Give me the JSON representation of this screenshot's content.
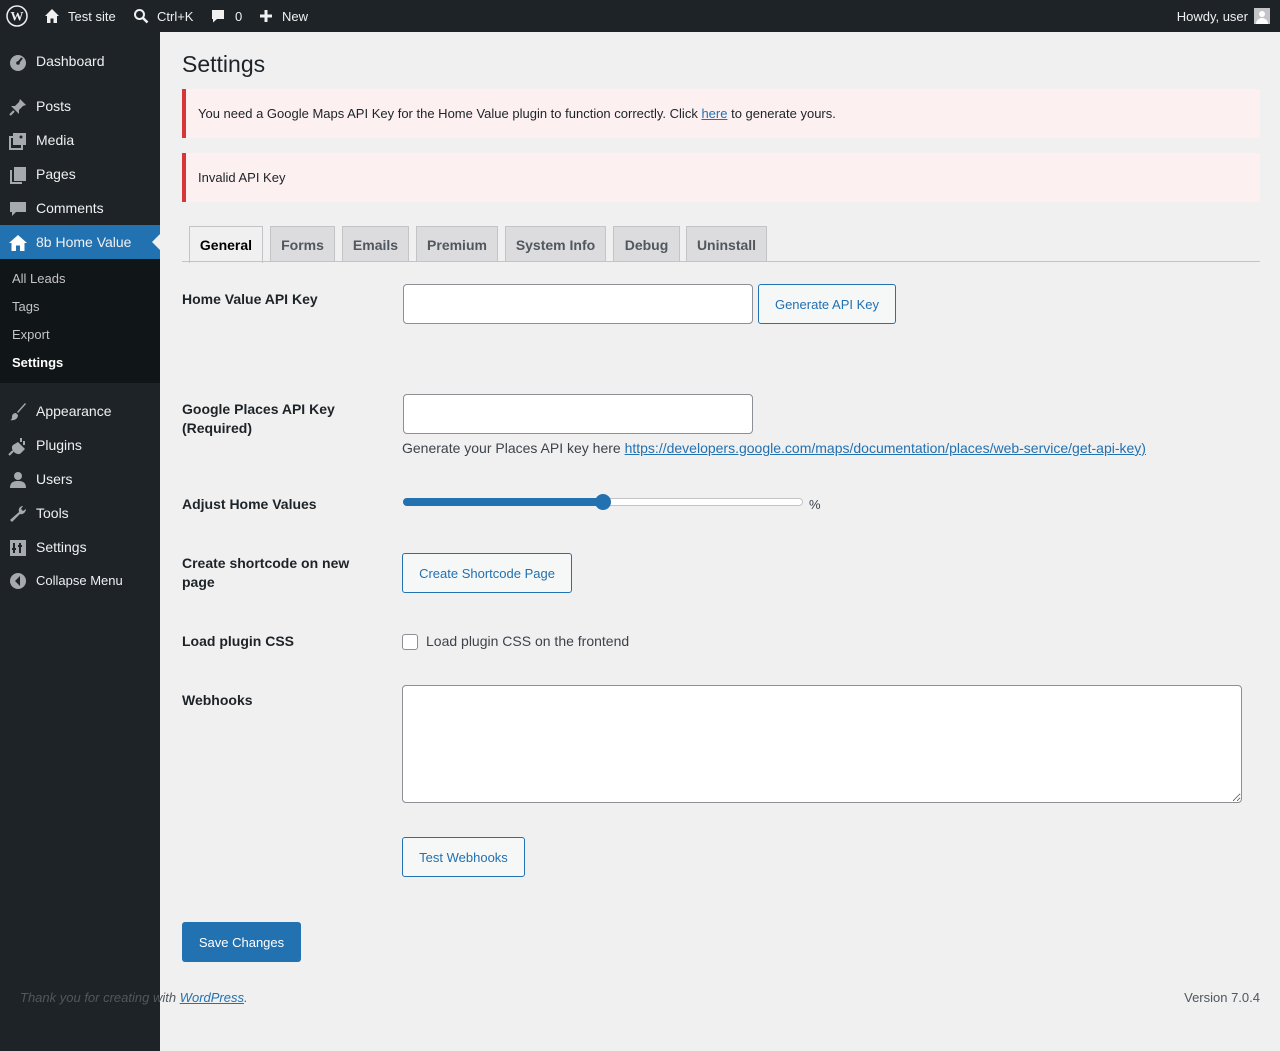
{
  "colors": {
    "adminbar_bg": "#1d2327",
    "accent": "#2271b1",
    "error": "#d63638"
  },
  "adminbar": {
    "site_name": "Test site",
    "search_shortcut": "Ctrl+K",
    "comments_count": "0",
    "new_label": "New",
    "greeting": "Howdy, user",
    "icons": [
      "wordpress-logo-icon",
      "home-icon",
      "search-icon",
      "comment-icon",
      "plus-icon",
      "avatar"
    ]
  },
  "sidebar": {
    "items": [
      {
        "label": "Dashboard",
        "icon": "dashboard-icon"
      },
      {
        "label": "Posts",
        "icon": "pin-icon"
      },
      {
        "label": "Media",
        "icon": "media-icon"
      },
      {
        "label": "Pages",
        "icon": "pages-icon"
      },
      {
        "label": "Comments",
        "icon": "comment-icon"
      },
      {
        "label": "8b Home Value",
        "icon": "home-icon"
      },
      {
        "label": "Appearance",
        "icon": "brush-icon"
      },
      {
        "label": "Plugins",
        "icon": "plug-icon"
      },
      {
        "label": "Users",
        "icon": "user-icon"
      },
      {
        "label": "Tools",
        "icon": "wrench-icon"
      },
      {
        "label": "Settings",
        "icon": "settings-icon"
      },
      {
        "label": "Collapse Menu",
        "icon": "collapse-icon"
      }
    ],
    "submenu": [
      {
        "label": "All Leads"
      },
      {
        "label": "Tags"
      },
      {
        "label": "Export"
      },
      {
        "label": "Settings"
      }
    ]
  },
  "page": {
    "title": "Settings",
    "notice1": {
      "before": "You need a Google Maps API Key for the Home Value plugin to function correctly. Click ",
      "link": "here",
      "after": " to generate yours."
    },
    "notice2": "Invalid API Key",
    "tabs": [
      {
        "label": "General"
      },
      {
        "label": "Forms"
      },
      {
        "label": "Emails"
      },
      {
        "label": "Premium"
      },
      {
        "label": "System Info"
      },
      {
        "label": "Debug"
      },
      {
        "label": "Uninstall"
      }
    ],
    "fields": {
      "home_value_api_key": {
        "label": "Home Value API Key",
        "value": "",
        "button": "Generate API Key"
      },
      "google_places_api_key": {
        "label": "Google Places API Key (Required)",
        "value": "",
        "help_text": "Generate your Places API key here ",
        "help_link": "https://developers.google.com/maps/documentation/places/web-service/get-api-key)"
      },
      "adjust_home_values": {
        "label": "Adjust Home Values",
        "value_fraction": 0.5,
        "unit": "%"
      },
      "create_shortcode": {
        "label": "Create shortcode on new page",
        "button": "Create Shortcode Page"
      },
      "load_plugin_css": {
        "label": "Load plugin CSS",
        "checkbox_label": "Load plugin CSS on the frontend",
        "checked": false
      },
      "webhooks": {
        "label": "Webhooks",
        "value": "",
        "button": "Test Webhooks"
      }
    },
    "save_button": "Save Changes"
  },
  "footer": {
    "text": "Thank you for creating with ",
    "link": "WordPress",
    "suffix": ".",
    "version": "Version 7.0.4"
  }
}
